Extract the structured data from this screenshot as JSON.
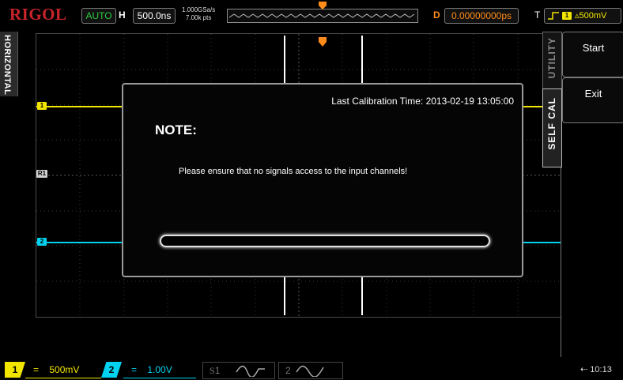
{
  "topbar": {
    "brand": "RIGOL",
    "run_status": "AUTO",
    "horizontal_label": "H",
    "timebase": "500.0ns",
    "sample_rate": "1.000GSa/s",
    "memory_depth": "7.00k pts",
    "delay_label": "D",
    "delay_value": "0.00000000ps",
    "trigger_label": "T",
    "trigger_level": "500mV"
  },
  "left_tab": {
    "label": "HORIZONTAL"
  },
  "markers": {
    "ch1": "1",
    "ref": "R1",
    "ch2": "2"
  },
  "dialog": {
    "calibration_time": "Last Calibration Time: 2013-02-19 13:05:00",
    "title": "NOTE:",
    "message": "Please ensure that no signals access to the input channels!",
    "progress": 0
  },
  "menu": {
    "tab_utility": "UTILITY",
    "tab_self_cal": "SELF CAL",
    "start_label": "Start",
    "exit_label": "Exit"
  },
  "bottom": {
    "ch1_num": "1",
    "ch1_coupling": "=",
    "ch1_scale": "500mV",
    "ch2_num": "2",
    "ch2_coupling": "=",
    "ch2_scale": "1.00V",
    "s1_label": "S",
    "s1_num": "1",
    "s2_num": "2",
    "clock": "10:13"
  },
  "colors": {
    "ch1": "#f2e600",
    "ch2": "#00d2ef",
    "brand": "#c9242b",
    "run": "#2ecc40",
    "delay": "#ff8c1a"
  }
}
